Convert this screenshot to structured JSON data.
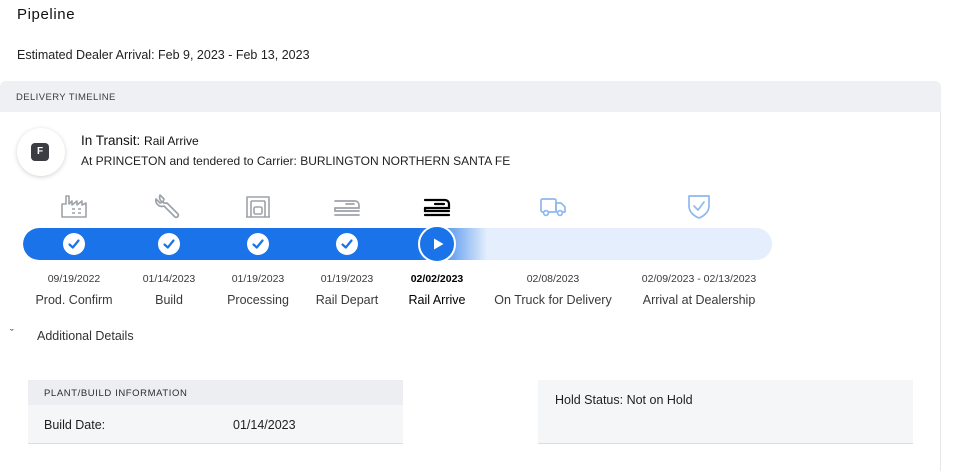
{
  "header": {
    "title": "Pipeline",
    "estimated_arrival": "Estimated Dealer Arrival: Feb 9, 2023 - Feb 13, 2023"
  },
  "timeline": {
    "section_title": "DELIVERY TIMELINE",
    "status": {
      "badge": "F",
      "label": "In Transit:",
      "sub": "Rail Arrive",
      "detail": "At PRINCETON and tendered to Carrier: BURLINGTON NORTHERN SANTA FE"
    },
    "stages": [
      {
        "date": "09/19/2022",
        "label": "Prod. Confirm",
        "state": "complete",
        "icon": "factory-icon"
      },
      {
        "date": "01/14/2023",
        "label": "Build",
        "state": "complete",
        "icon": "wrench-icon"
      },
      {
        "date": "01/19/2023",
        "label": "Processing",
        "state": "complete",
        "icon": "garage-icon"
      },
      {
        "date": "01/19/2023",
        "label": "Rail Depart",
        "state": "complete",
        "icon": "rail-car-icon"
      },
      {
        "date": "02/02/2023",
        "label": "Rail Arrive",
        "state": "current",
        "icon": "rail-car-icon"
      },
      {
        "date": "02/08/2023",
        "label": "On Truck for Delivery",
        "state": "pending",
        "icon": "truck-icon"
      },
      {
        "date": "02/09/2023 - 02/13/2023",
        "label": "Arrival at Dealership",
        "state": "pending",
        "icon": "shield-check-icon"
      }
    ],
    "colors": {
      "progress": "#1a73e8",
      "track": "#e4eefc",
      "complete_icon": "#9ea3a9",
      "current_icon": "#000000",
      "pending_icon": "#8fb8ee"
    }
  },
  "details": {
    "toggle_label": "Additional Details",
    "plant": {
      "section_title": "PLANT/BUILD INFORMATION",
      "build_date_label": "Build Date:",
      "build_date": "01/14/2023"
    },
    "hold_status": "Hold Status: Not on Hold"
  }
}
